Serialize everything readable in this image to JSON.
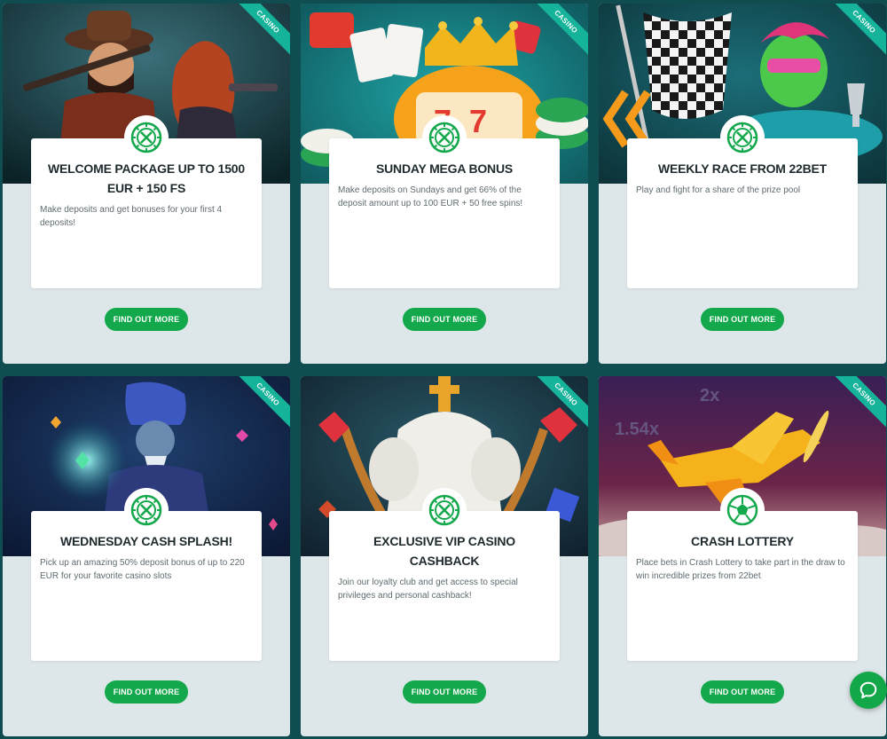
{
  "cards": [
    {
      "category": "CASINO",
      "title": "WELCOME PACKAGE UP TO 1500 EUR + 150 FS",
      "description": "Make deposits and get bonuses for your first 4 deposits!",
      "button": "FIND OUT MORE",
      "icon": "casino-chip-icon",
      "image": "cowboy-gunslingers-illustration"
    },
    {
      "category": "CASINO",
      "title": "SUNDAY MEGA BONUS",
      "description": "Make deposits on Sundays and get 66% of the deposit amount up to 100 EUR + 50 free spins!",
      "button": "FIND OUT MORE",
      "icon": "casino-chip-icon",
      "image": "slot-machine-crown-illustration"
    },
    {
      "category": "CASINO",
      "title": "WEEKLY RACE FROM 22BET",
      "description": "Play and fight for a share of the prize pool",
      "button": "FIND OUT MORE",
      "icon": "casino-chip-icon",
      "image": "racing-frog-checkered-flag-illustration"
    },
    {
      "category": "CASINO",
      "title": "WEDNESDAY CASH SPLASH!",
      "description": "Pick up an amazing 50% deposit bonus of up to 220 EUR for your favorite casino slots",
      "button": "FIND OUT MORE",
      "icon": "casino-chip-icon",
      "image": "genie-wizard-illustration"
    },
    {
      "category": "CASINO",
      "title": "EXCLUSIVE VIP CASINO CASHBACK",
      "description": "Join our loyalty club and get access to special privileges and personal cashback!",
      "button": "FIND OUT MORE",
      "icon": "casino-chip-icon",
      "image": "vip-crown-illustration"
    },
    {
      "category": "CASINO",
      "title": "CRASH LOTTERY",
      "description": "Place bets in Crash Lottery to take part in the draw to win incredible prizes from 22bet",
      "button": "FIND OUT MORE",
      "icon": "soccer-ball-icon",
      "image": "crash-plane-illustration",
      "image_text": [
        "2x",
        "1.54x"
      ]
    }
  ],
  "colors": {
    "page_background": "#0f4d50",
    "card_background": "#dde6e9",
    "accent_green": "#13a84b",
    "ribbon_teal": "#14b39a"
  },
  "chat_button": {
    "icon": "chat-bubble-icon"
  }
}
